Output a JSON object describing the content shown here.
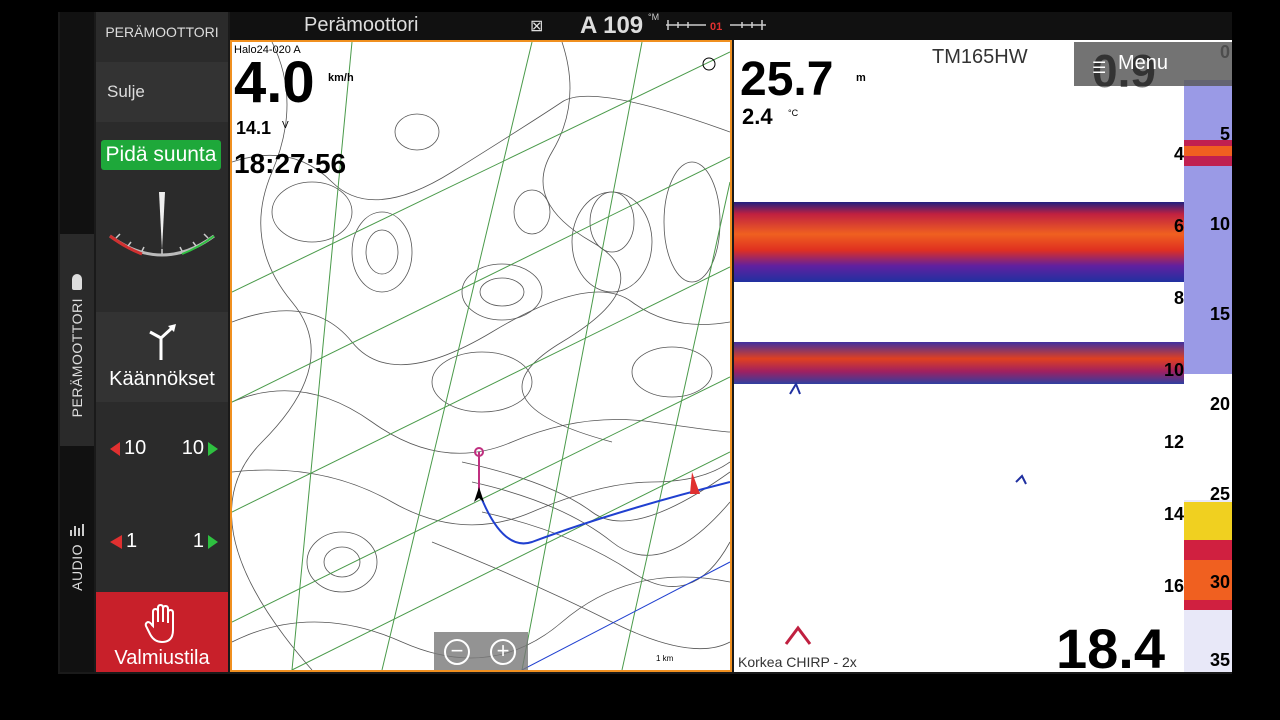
{
  "vtabs": {
    "engine": "PERÄMOOTTORI",
    "audio": "AUDIO"
  },
  "panel": {
    "title": "PERÄMOOTTORI",
    "close": "Sulje",
    "hold": "Pidä suunta",
    "turns": "Käännökset",
    "row1_left": "10",
    "row1_right": "10",
    "row2_left": "1",
    "row2_right": "1",
    "standby": "Valmiustila"
  },
  "topbar": {
    "title": "Perämoottori",
    "close_icon": "⊠",
    "heading": "A 109",
    "heading_unit": "°M",
    "xte": "01"
  },
  "chart": {
    "source": "Halo24-020 A",
    "speed": "4.0",
    "speed_unit": "km/h",
    "voltage": "14.1",
    "voltage_unit": "V",
    "time": "18:27:56",
    "scale": "1 km",
    "zoom_out": "−",
    "zoom_in": "+"
  },
  "sonar": {
    "depth": "25.7",
    "depth_unit": "m",
    "temp": "2.4",
    "temp_unit": "°C",
    "model": "TM165HW",
    "menu_value": "0.9",
    "menu": "Menu",
    "mode": "Korkea CHIRP - 2x",
    "big_value": "18.4",
    "depth_scale": [
      "4",
      "6",
      "8",
      "10",
      "12",
      "14",
      "16"
    ],
    "right_scale": [
      "0",
      "5",
      "10",
      "15",
      "20",
      "25",
      "30",
      "35"
    ]
  },
  "colors": {
    "standby": "#c8202a",
    "hold": "#1ea83a",
    "chart_border": "#f09020"
  }
}
